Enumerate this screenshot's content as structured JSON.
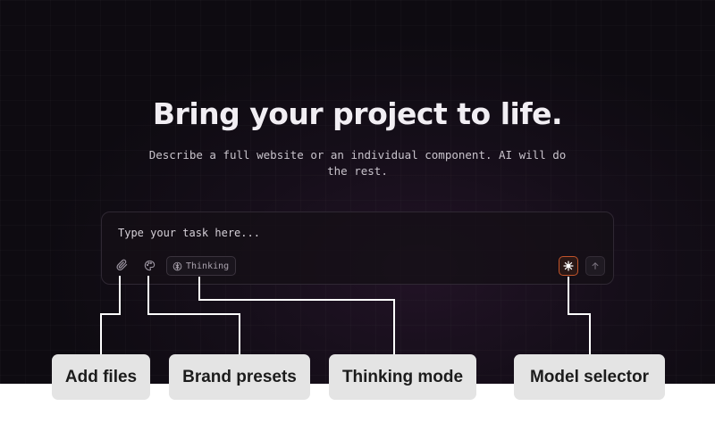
{
  "hero": {
    "title": "Bring your project to life.",
    "subtitle_line1": "Describe a full website or an individual component. AI will do",
    "subtitle_line2": "the rest."
  },
  "prompt": {
    "placeholder": "Type your task here...",
    "thinking_label": "Thinking"
  },
  "icons": {
    "attach": "paperclip-icon",
    "brand": "palette-icon",
    "thinking": "brain-icon",
    "model": "sparkle-icon",
    "send": "arrow-up-icon"
  },
  "callouts": {
    "add_files": "Add files",
    "brand_presets": "Brand presets",
    "thinking_mode": "Thinking mode",
    "model_selector": "Model selector"
  },
  "colors": {
    "accent": "#c2542a",
    "callout_bg": "#e4e4e4",
    "connector": "#ffffff"
  }
}
